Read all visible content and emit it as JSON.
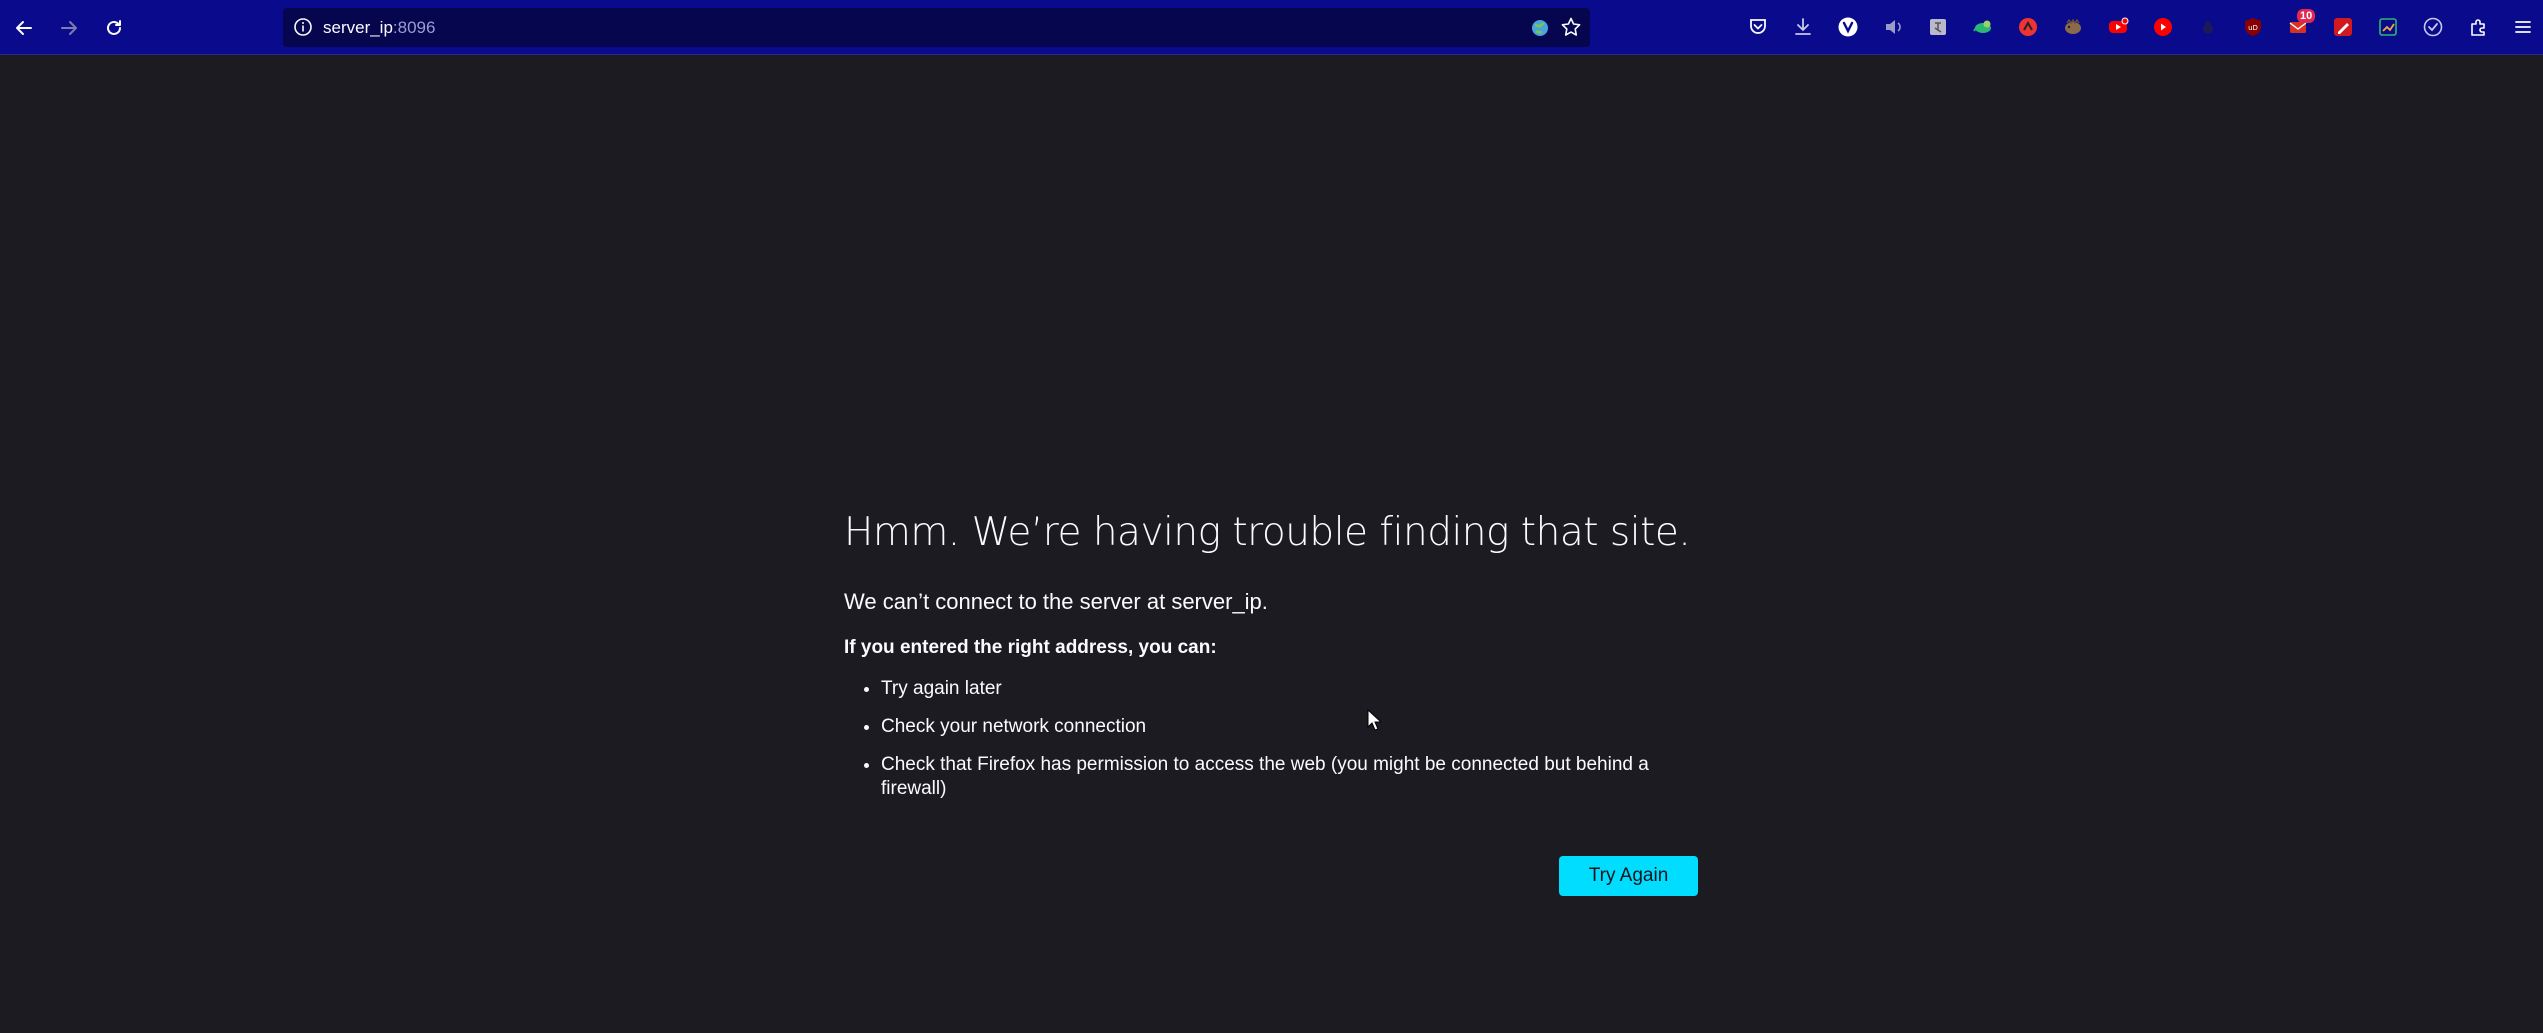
{
  "toolbar": {
    "url_host": "server_ip",
    "url_port": ":8096",
    "notification_badge": "10",
    "extensions": [
      "pocket-icon",
      "download-icon",
      "vivaldi-v-icon",
      "speaker-icon",
      "translate-icon",
      "bird-icon",
      "red-circle-icon",
      "hedgehog-icon",
      "youtube-red-icon",
      "youtube-icon",
      "dark-drop-icon",
      "ublock-icon",
      "mail-icon",
      "pen-icon",
      "chart-icon",
      "check-circle-icon",
      "extensions-puzzle-icon",
      "menu-icon"
    ]
  },
  "error": {
    "title": "Hmm. We’re having trouble finding that site.",
    "short_desc": "We can’t connect to the server at server_ip.",
    "advice_heading": "If you entered the right address, you can:",
    "advice_items": [
      "Try again later",
      "Check your network connection",
      "Check that Firefox has permission to access the web (you might be connected but behind a firewall)"
    ],
    "try_again_label": "Try Again"
  },
  "colors": {
    "toolbar_bg": "#0a0a8c",
    "page_bg": "#1c1b22",
    "button_accent": "#00ddff"
  }
}
